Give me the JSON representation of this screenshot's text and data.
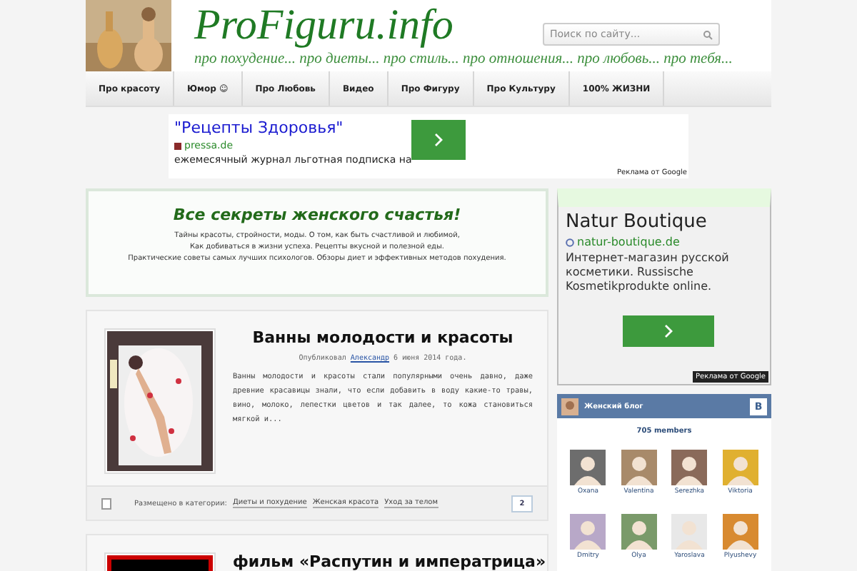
{
  "header": {
    "title": "ProFiguru.info",
    "tagline": "про похудение... про диеты... про стиль... про отношения... про любовь... про тебя...",
    "search": {
      "placeholder": "Поиск по сайту..."
    }
  },
  "nav": [
    "Про красоту",
    "Юмор ☺",
    "Про Любовь",
    "Видео",
    "Про Фигуру",
    "Про Культуру",
    "100% ЖИЗНИ"
  ],
  "top_ad": {
    "title": "\"Рецепты Здоровья\"",
    "domain": "pressa.de",
    "text": "ежемесячный журнал льготная подписка на",
    "badge": "Реклама от Google"
  },
  "intro": {
    "heading": "Все секреты женского счастья!",
    "lines": [
      "Тайны красоты, стройности, моды. О том, как быть счастливой и любимой,",
      "Как добиваться в жизни успеха. Рецепты вкусной и полезной еды.",
      "Практические советы самых лучших психологов. Обзоры диет и эффективных методов похудения."
    ]
  },
  "posts": [
    {
      "title": "Ванны молодости и красоты",
      "byline": "Опубликовал",
      "author": "Александр",
      "date": "6 июня 2014 года.",
      "excerpt": "Ванны молодости и красоты стали популярными очень давно, даже древние красавицы знали, что если добавить в воду какие-то травы, вино, молоко, лепестки цветов и так далее, то кожа становиться мягкой и...",
      "category_label": "Размещено в категории:",
      "categories": [
        "Диеты и похудение",
        "Женская красота",
        "Уход за телом"
      ],
      "comments": "2"
    },
    {
      "title": "фильм «Распутин и императрица»"
    }
  ],
  "side_ad": {
    "title": "Natur Boutique",
    "domain": "natur-boutique.de",
    "text": "Интернет-магазин русской косметики. Russische Kosmetikprodukte online.",
    "badge": "Реклама от Google"
  },
  "vk": {
    "title": "Женский блог",
    "logo": "В",
    "members": "705 members",
    "people": [
      "Oxana",
      "Valentina",
      "Serezhka",
      "Viktoria",
      "Dmitry",
      "Olya",
      "Yaroslava",
      "Plyushevy"
    ]
  }
}
